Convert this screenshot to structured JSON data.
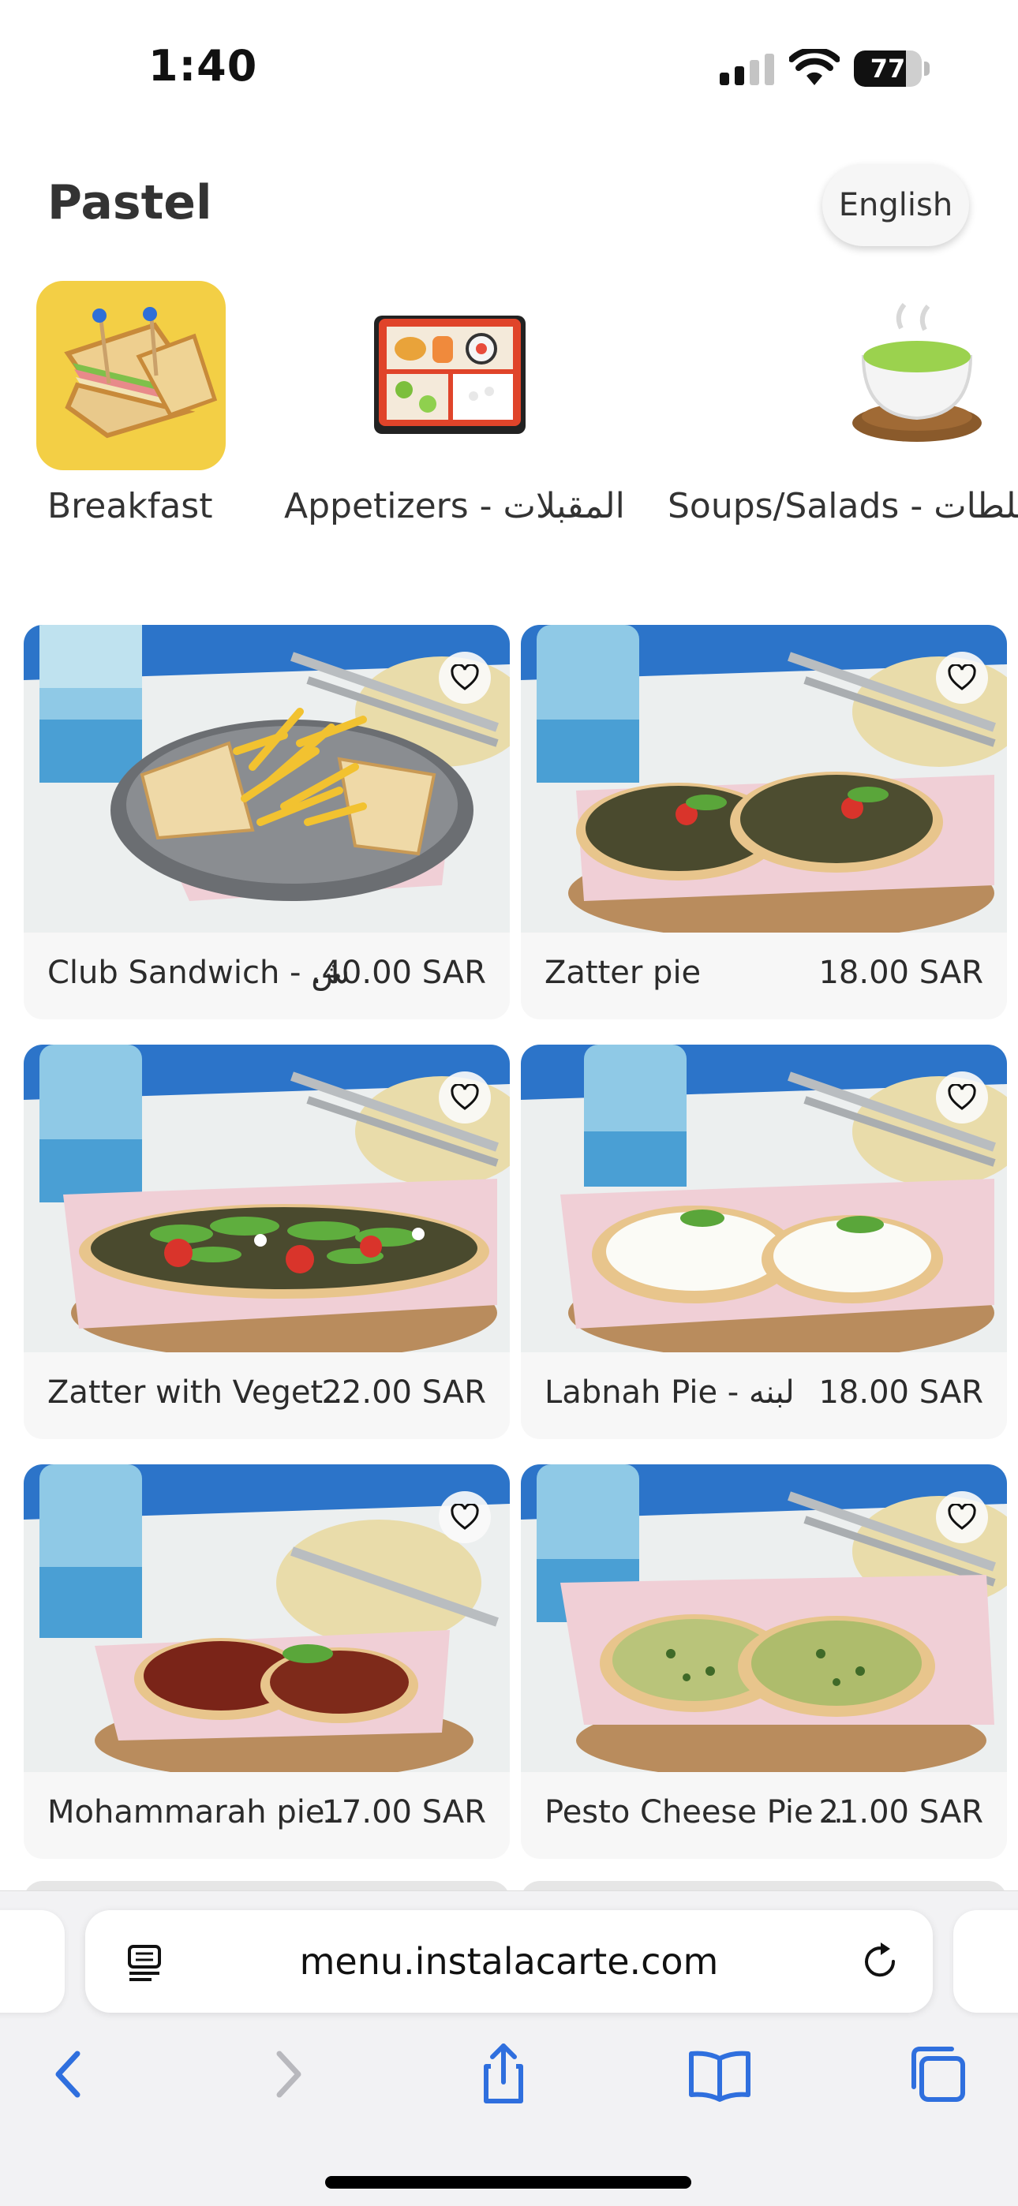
{
  "status_bar": {
    "time": "1:40",
    "battery": "77",
    "battery_level": 0.77
  },
  "header": {
    "title": "Pastel",
    "language": "English"
  },
  "categories": [
    {
      "label": "Breakfast",
      "icon": "sandwich-icon"
    },
    {
      "label": "Appetizers - المقبلات",
      "icon": "bento-box-icon"
    },
    {
      "label": "Soups/Salads - سلطات",
      "icon": "teacup-icon"
    }
  ],
  "products": [
    {
      "name": "Club Sandwich - ش",
      "price": ".40.00 SAR"
    },
    {
      "name": "Zatter pie",
      "price": "18.00 SAR"
    },
    {
      "name": "Zatter with Veget...",
      "price": "22.00 SAR"
    },
    {
      "name": "Labnah Pie - لبنه",
      "price": "18.00 SAR"
    },
    {
      "name": "Mohammarah pie...",
      "price": "17.00 SAR"
    },
    {
      "name": "Pesto Cheese Pie ...",
      "price": "21.00 SAR"
    }
  ],
  "browser": {
    "url": "menu.instalacarte.com"
  },
  "colors": {
    "accent": "#2f6fde",
    "breakfast_tile": "#f3cf45",
    "paper_pink": "#f0cfd6"
  }
}
